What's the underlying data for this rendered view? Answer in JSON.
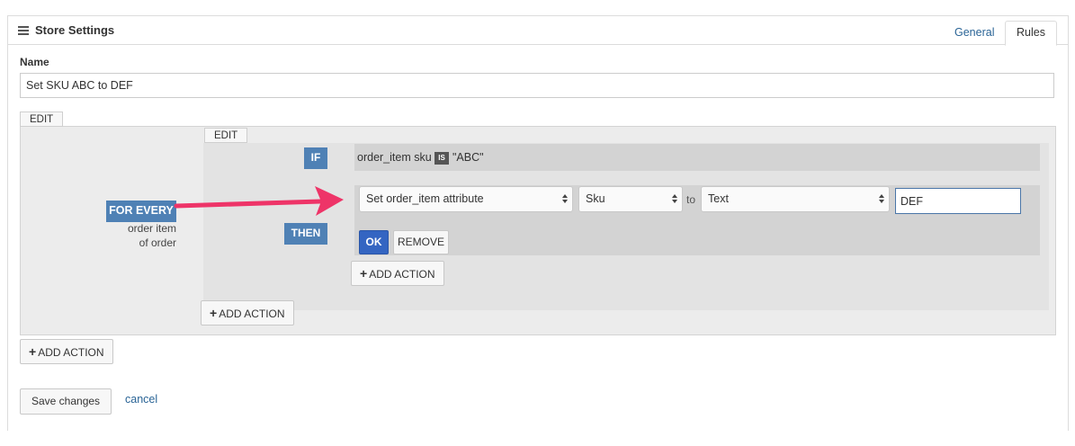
{
  "header": {
    "title": "Store Settings",
    "menu_icon": "hamburger-icon",
    "tabs": [
      {
        "label": "General"
      },
      {
        "label": "Rules"
      }
    ]
  },
  "name_field": {
    "label": "Name",
    "value": "Set SKU ABC to DEF"
  },
  "outer_rule": {
    "edit_label": "EDIT",
    "for_every_label": "FOR EVERY",
    "for_every_text_line1": "order item",
    "for_every_text_line2": "of order"
  },
  "inner_rule": {
    "edit_label": "EDIT",
    "if_label": "IF",
    "condition": {
      "field": "order_item sku",
      "operator": "IS",
      "value": "\"ABC\""
    },
    "then_label": "THEN",
    "action": {
      "type_select": "Set order_item attribute",
      "attribute_select": "Sku",
      "to_label": "to",
      "value_type_select": "Text",
      "value_input": "DEF"
    },
    "ok_label": "OK",
    "remove_label": "REMOVE"
  },
  "add_action_label": "ADD ACTION",
  "footer": {
    "save_label": "Save changes",
    "cancel_label": "cancel"
  },
  "colors": {
    "badge_blue": "#4f81b5",
    "ok_blue": "#3465c2",
    "arrow_pink": "#ee3468",
    "link_blue": "#2a6496"
  }
}
